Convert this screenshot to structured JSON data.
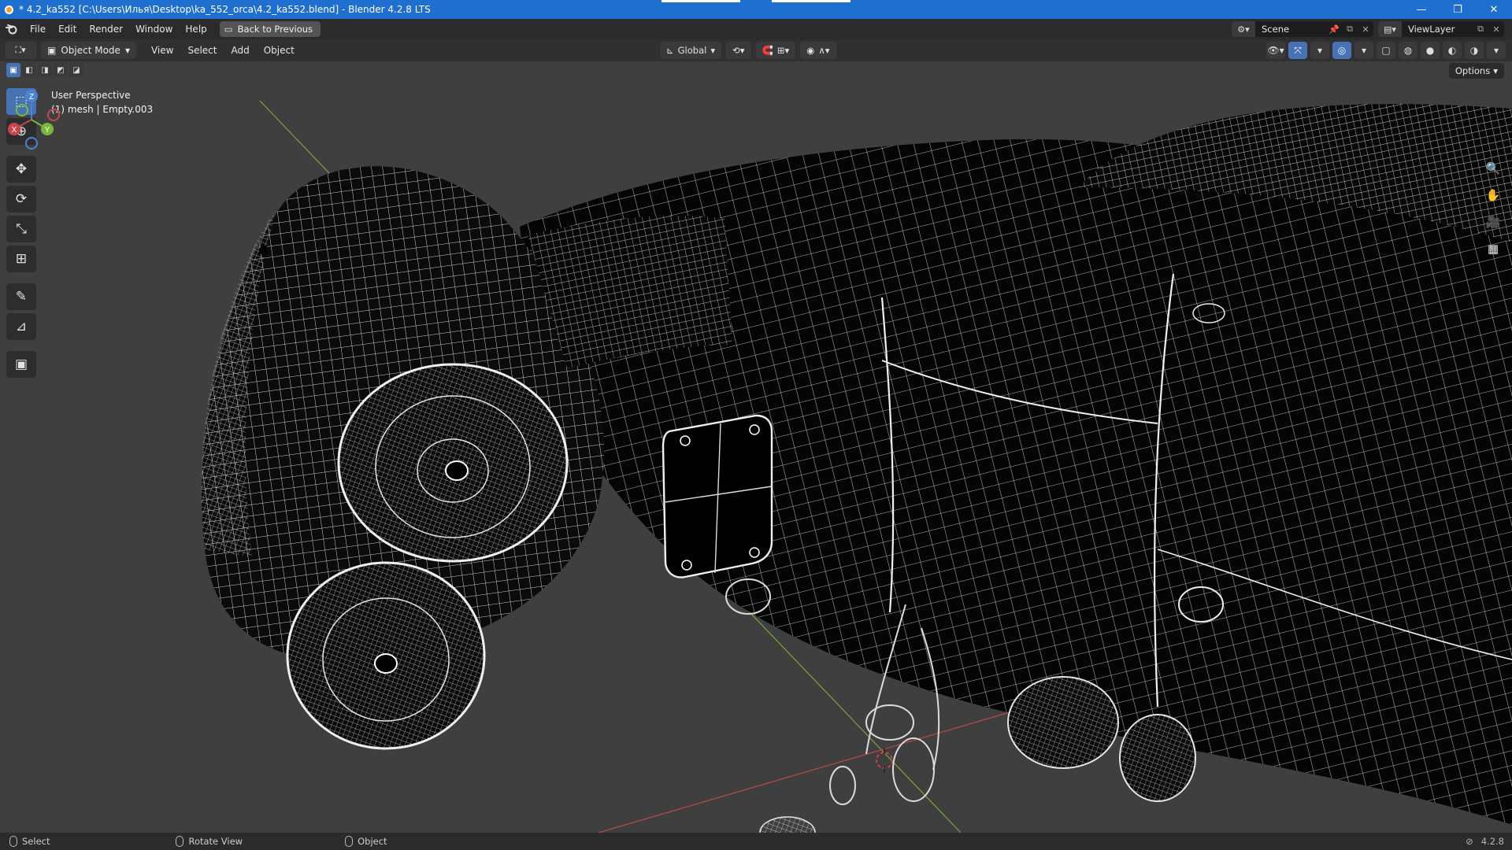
{
  "window": {
    "title": "* 4.2_ka552 [C:\\Users\\Илья\\Desktop\\ka_552_orca\\4.2_ka552.blend] - Blender 4.2.8 LTS",
    "controls": {
      "minimize": "—",
      "maximize": "❐",
      "close": "✕"
    }
  },
  "menubar": {
    "items": [
      "File",
      "Edit",
      "Render",
      "Window",
      "Help"
    ],
    "back_button": "Back to Previous",
    "scene": {
      "label": "Scene",
      "icon": "scene-icon"
    },
    "view_layer": {
      "label": "ViewLayer",
      "icon": "view-layer-icon"
    }
  },
  "header": {
    "mode": "Object Mode",
    "menus": [
      "View",
      "Select",
      "Add",
      "Object"
    ],
    "transform_orientation": "Global",
    "options_label": "Options"
  },
  "viewport": {
    "view_name": "User Perspective",
    "object_info": "(1) mesh | Empty.003",
    "shading": "wireframe",
    "background_color": "#3f3f3f",
    "axis_x_color": "#b84a4a",
    "axis_y_color": "#7aa43a"
  },
  "gizmo": {
    "x": "X",
    "y": "Y",
    "z": "Z"
  },
  "toolbar": {
    "tools": [
      {
        "name": "select-box-tool",
        "glyph": "⬚",
        "active": true
      },
      {
        "name": "cursor-tool",
        "glyph": "⊕",
        "active": false
      },
      {
        "name": "move-tool",
        "glyph": "✥",
        "active": false
      },
      {
        "name": "rotate-tool",
        "glyph": "⟳",
        "active": false
      },
      {
        "name": "scale-tool",
        "glyph": "⤡",
        "active": false
      },
      {
        "name": "transform-tool",
        "glyph": "⊞",
        "active": false
      },
      {
        "name": "annotate-tool",
        "glyph": "✎",
        "active": false
      },
      {
        "name": "measure-tool",
        "glyph": "📐",
        "active": false
      },
      {
        "name": "add-cube-tool",
        "glyph": "▣",
        "active": false
      }
    ]
  },
  "statusbar": {
    "select": "Select",
    "rotate": "Rotate View",
    "object": "Object",
    "version": "4.2.8"
  }
}
